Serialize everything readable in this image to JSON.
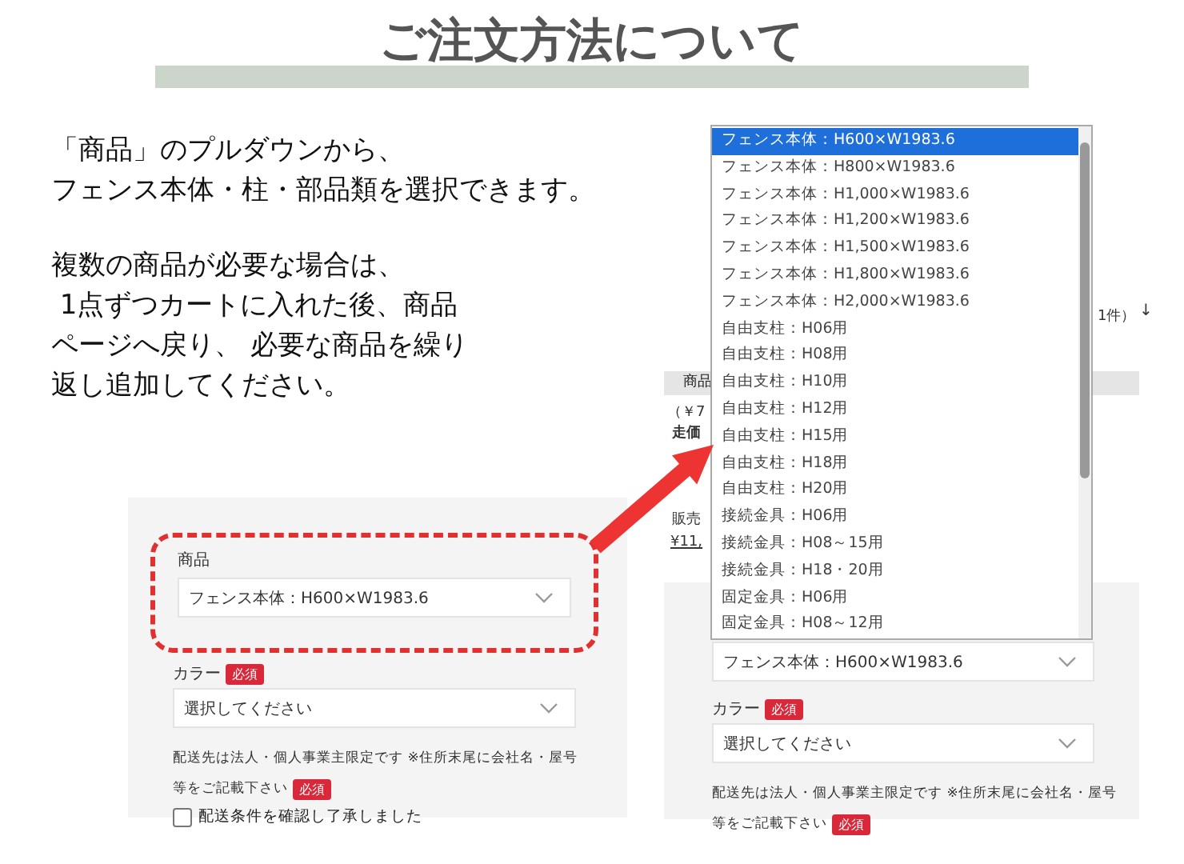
{
  "title": "ご注文方法について",
  "instructions": [
    [
      "「商品」のプルダウンから、",
      "フェンス本体・柱・部品類を選択できます。"
    ],
    [
      "複数の商品が必要な場合は、",
      " 1点ずつカートに入れた後、商品",
      "ページへ戻り、 必要な商品を繰り",
      "返し追加してください。"
    ]
  ],
  "form_before": {
    "product_label": "商品",
    "product_value": "フェンス本体：H600×W1983.6",
    "color_label": "カラー",
    "color_required": "必須",
    "color_placeholder": "選択してください",
    "delivery_note": [
      "配送先は法人・個人事業主限定です ※住所末尾に会社名・屋号",
      "等をご記載下さい"
    ],
    "delivery_required": "必須",
    "confirm_label": "配送条件を確認し了承しました",
    "confirm_checked": false
  },
  "page_behind": {
    "count": "1件）",
    "sort_icon": "↓",
    "row_label": "商品",
    "price_fragment": "（￥7",
    "label_fragment": "走価",
    "sales_fragment": "販売",
    "amount_fragment": "¥11,"
  },
  "dropdown": [
    {
      "label": "フェンス本体：H600×W1983.6",
      "selected": true
    },
    {
      "label": "フェンス本体：H800×W1983.6",
      "selected": false
    },
    {
      "label": "フェンス本体：H1,000×W1983.6",
      "selected": false
    },
    {
      "label": "フェンス本体：H1,200×W1983.6",
      "selected": false
    },
    {
      "label": "フェンス本体：H1,500×W1983.6",
      "selected": false
    },
    {
      "label": "フェンス本体：H1,800×W1983.6",
      "selected": false
    },
    {
      "label": "フェンス本体：H2,000×W1983.6",
      "selected": false
    },
    {
      "label": "自由支柱：H06用",
      "selected": false
    },
    {
      "label": "自由支柱：H08用",
      "selected": false
    },
    {
      "label": "自由支柱：H10用",
      "selected": false
    },
    {
      "label": "自由支柱：H12用",
      "selected": false
    },
    {
      "label": "自由支柱：H15用",
      "selected": false
    },
    {
      "label": "自由支柱：H18用",
      "selected": false
    },
    {
      "label": "自由支柱：H20用",
      "selected": false
    },
    {
      "label": "接続金具：H06用",
      "selected": false
    },
    {
      "label": "接続金具：H08～15用",
      "selected": false
    },
    {
      "label": "接続金具：H18・20用",
      "selected": false
    },
    {
      "label": "固定金具：H06用",
      "selected": false
    },
    {
      "label": "固定金具：H08～12用",
      "selected": false
    }
  ],
  "form_after": {
    "product_value": "フェンス本体：H600×W1983.6",
    "color_label": "カラー",
    "color_required": "必須",
    "color_placeholder": "選択してください",
    "delivery_note": [
      "配送先は法人・個人事業主限定です ※住所末尾に会社名・屋号",
      "等をご記載下さい"
    ],
    "delivery_required": "必須"
  }
}
